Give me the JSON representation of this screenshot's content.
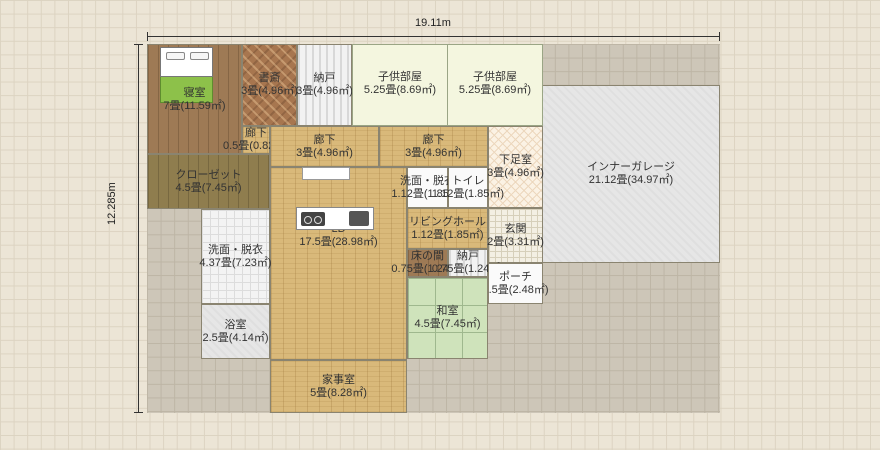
{
  "dimensions": {
    "width_label": "19.11m",
    "height_label": "12.285m"
  },
  "rooms": {
    "bedroom": {
      "name": "寝室",
      "area": "7畳(11.59㎡)"
    },
    "study": {
      "name": "書斎",
      "area": "3畳(4.96㎡)"
    },
    "storage1": {
      "name": "納戸",
      "area": "3畳(4.96㎡)"
    },
    "kids1": {
      "name": "子供部屋",
      "area": "5.25畳(8.69㎡)"
    },
    "kids2": {
      "name": "子供部屋",
      "area": "5.25畳(8.69㎡)"
    },
    "hall_small": {
      "name": "廊下",
      "area": "0.5畳(0.82㎡)"
    },
    "hall1": {
      "name": "廊下",
      "area": "3畳(4.96㎡)"
    },
    "hall2": {
      "name": "廊下",
      "area": "3畳(4.96㎡)"
    },
    "closet": {
      "name": "クローゼット",
      "area": "4.5畳(7.45㎡)"
    },
    "shoe_room": {
      "name": "下足室",
      "area": "3畳(4.96㎡)"
    },
    "garage": {
      "name": "インナーガレージ",
      "area": "21.12畳(34.97㎡)"
    },
    "washroom1": {
      "name": "洗面・脱衣",
      "area": "1.12畳(1.85㎡)"
    },
    "toilet": {
      "name": "トイレ",
      "area": "1.12畳(1.85㎡)"
    },
    "living_hall": {
      "name": "リビングホール",
      "area": "1.12畳(1.85㎡)"
    },
    "entrance": {
      "name": "玄関",
      "area": "2畳(3.31㎡)"
    },
    "washroom2": {
      "name": "洗面・脱衣",
      "area": "4.37畳(7.23㎡)"
    },
    "ld": {
      "name": "LD",
      "area": "17.5畳(28.98㎡)"
    },
    "tokonoma": {
      "name": "床の間",
      "area": "0.75畳(1.24㎡)"
    },
    "storage2": {
      "name": "納戸",
      "area": "0.75畳(1.24㎡)"
    },
    "porch": {
      "name": "ポーチ",
      "area": "1.5畳(2.48㎡)"
    },
    "bath": {
      "name": "浴室",
      "area": "2.5畳(4.14㎡)"
    },
    "washitsu": {
      "name": "和室",
      "area": "4.5畳(7.45㎡)"
    },
    "utility": {
      "name": "家事室",
      "area": "5畳(8.28㎡)"
    }
  }
}
